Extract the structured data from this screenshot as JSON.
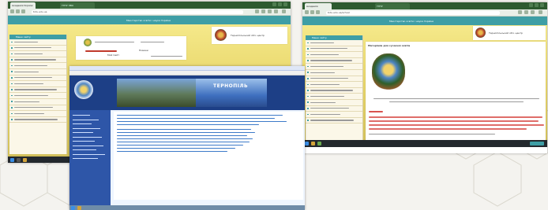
{
  "colors": {
    "teal": "#3e9ea5",
    "browser_green": "#2d5a2f",
    "sidebar_cream": "#fbf7e8",
    "old_site_navy": "#2e56a8",
    "old_site_panel": "#eef5ff",
    "taskbar": "#23282d"
  },
  "left_browser": {
    "tabs": [
      "Академія Україні",
      "ТНТУ ЗВО"
    ],
    "url": "tntu.edu.ua",
    "header_text": "Міністерство освіти і науки України",
    "sidebar_title": "Меню сайту",
    "header_right_text": "Тернопільський обл. центр",
    "center_text_1": "Мой Сайт",
    "center_text_2": "Новини",
    "sidebar_items": [
      "",
      "",
      "",
      "",
      "",
      "",
      "",
      "",
      "",
      "",
      "",
      "",
      "",
      ""
    ]
  },
  "center_window": {
    "banner_word": "ТЕРНОПІЛЬ",
    "menu_items": [
      "",
      "",
      "",
      "",
      "",
      "",
      "",
      "",
      "",
      "",
      ""
    ]
  },
  "right_browser": {
    "tabs": [
      "Академія",
      "ТНТУ"
    ],
    "url": "tntu.edu.ua/school",
    "header_text": "Міністерство освіти і науки України",
    "sidebar_title": "Меню сайту",
    "header_right_text": "Тернопільський обл. центр",
    "content_title": "Матеріали для сучасної освіти",
    "sidebar_items": [
      "",
      "",
      "",
      "",
      "",
      "",
      "",
      "",
      "",
      "",
      "",
      "",
      "",
      ""
    ]
  },
  "icons": {
    "tab_close": "close-icon",
    "window_controls": [
      "minimize-icon",
      "maximize-icon",
      "close-icon"
    ],
    "emblem": "coat-of-arms-icon",
    "school_logo": "school-emblem-icon"
  }
}
